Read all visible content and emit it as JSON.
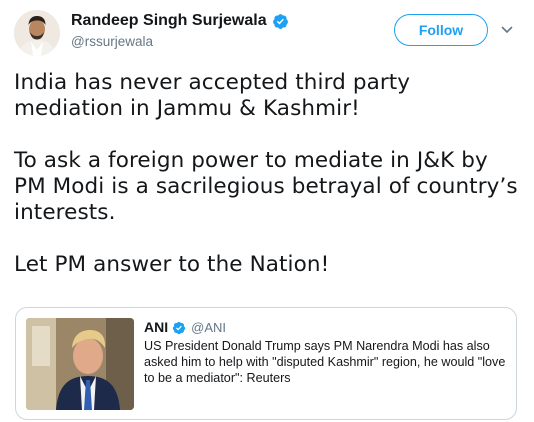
{
  "author": {
    "name": "Randeep Singh Surjewala",
    "handle": "@rssurjewala",
    "verified_icon": "verified-badge-icon"
  },
  "actions": {
    "follow_label": "Follow",
    "more_icon": "chevron-down-icon"
  },
  "tweet": {
    "paragraphs": [
      "India has never accepted third party mediation in Jammu & Kashmir!",
      "To ask a foreign power to mediate in J&K by PM Modi is a sacrilegious betrayal of country’s interests.",
      "Let PM answer to the Nation!"
    ]
  },
  "quoted_tweet": {
    "name": "ANI",
    "handle": "@ANI",
    "text": "US President Donald Trump says PM Narendra Modi has also asked him to help with \"disputed Kashmir\" region, he would \"love to be a mediator\": Reuters"
  },
  "colors": {
    "accent": "#1da1f2",
    "text": "#14171a",
    "muted": "#657786",
    "border": "#ccd6dd"
  }
}
